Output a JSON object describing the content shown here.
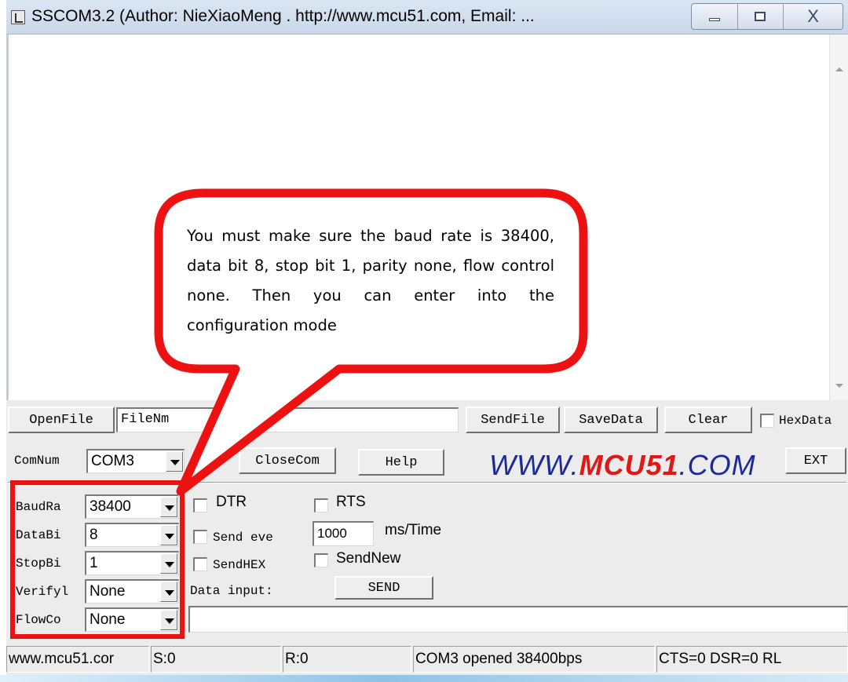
{
  "window": {
    "title": "SSCOM3.2 (Author: NieXiaoMeng .  http://www.mcu51.com,  Email: ...",
    "minimize_icon": "minimize-icon",
    "maximize_icon": "maximize-icon",
    "close_glyph": "X"
  },
  "toolbar": {
    "open_file": "OpenFile",
    "file_name": "FileNm",
    "send_file": "SendFile",
    "save_data": "SaveData",
    "clear": "Clear",
    "hex_data": "HexData"
  },
  "port_row": {
    "com_num_label": "ComNum",
    "com_num_value": "COM3",
    "close_com": "CloseCom",
    "help": "Help",
    "logo_left": "WWW.",
    "logo_mid": "MCU51",
    "logo_right": ".COM",
    "ext": "EXT"
  },
  "settings": [
    {
      "label": "BaudRa",
      "value": "38400"
    },
    {
      "label": "DataBi",
      "value": "8"
    },
    {
      "label": "StopBi",
      "value": "1"
    },
    {
      "label": "Verifyl",
      "value": "None"
    },
    {
      "label": "FlowCo",
      "value": "None"
    }
  ],
  "options": {
    "dtr": "DTR",
    "rts": "RTS",
    "send_every": "Send eve",
    "interval": "1000",
    "interval_unit": "ms/Time",
    "send_hex": "SendHEX",
    "send_new": "SendNew",
    "data_input": "Data input:",
    "send": "SEND"
  },
  "status": {
    "site": "www.mcu51.cor",
    "sent": "S:0",
    "received": "R:0",
    "port_state": "COM3 opened 38400bps",
    "lines": "CTS=0 DSR=0 RL"
  },
  "callout": {
    "text": "You must make sure the baud rate is 38400, data bit 8, stop bit 1, parity none, flow control none. Then you can enter into the configuration mode",
    "color": "#ee1111"
  }
}
